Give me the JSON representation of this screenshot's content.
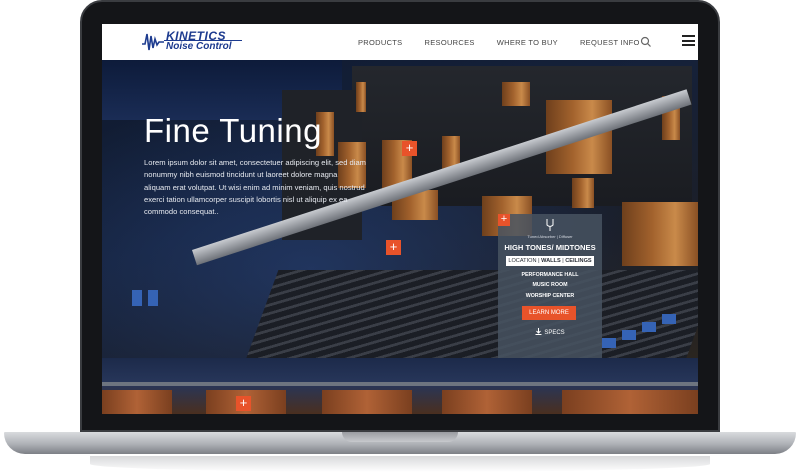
{
  "logo": {
    "line1": "KINETICS",
    "line2": "Noise Control"
  },
  "nav": {
    "items": [
      {
        "label": "PRODUCTS"
      },
      {
        "label": "RESOURCES"
      },
      {
        "label": "WHERE TO BUY"
      },
      {
        "label": "REQUEST INFO"
      }
    ],
    "search_icon": "search-icon",
    "menu_icon": "hamburger-menu-icon"
  },
  "hero": {
    "title": "Fine Tuning",
    "body": "Lorem ipsum dolor sit amet, consectetuer adipiscing elit, sed diam nonummy nibh euismod tincidunt ut laoreet dolore magna aliquam erat volutpat. Ut wisi enim ad minim veniam, quis nostrud exerci tation ullamcorper suscipit lobortis nisl ut aliquip ex ea commodo consequat.."
  },
  "hotspots": {
    "plus_label": "+"
  },
  "card": {
    "plus_label": "+",
    "subtitle": "Tuned Absorber | Diffuser",
    "headline": "HIGH TONES/ MIDTONES",
    "tag_location": "LOCATION",
    "tag_sep": " | ",
    "tag_walls": "WALLS",
    "tag_ceilings": "CEILINGS",
    "uses": [
      "PERFORMANCE HALL",
      "MUSIC ROOM",
      "WORSHIP CENTER"
    ],
    "learn_more": "LEARN MORE",
    "specs": "SPECS"
  },
  "colors": {
    "accent": "#e8532a",
    "brand": "#1d3b8f"
  }
}
